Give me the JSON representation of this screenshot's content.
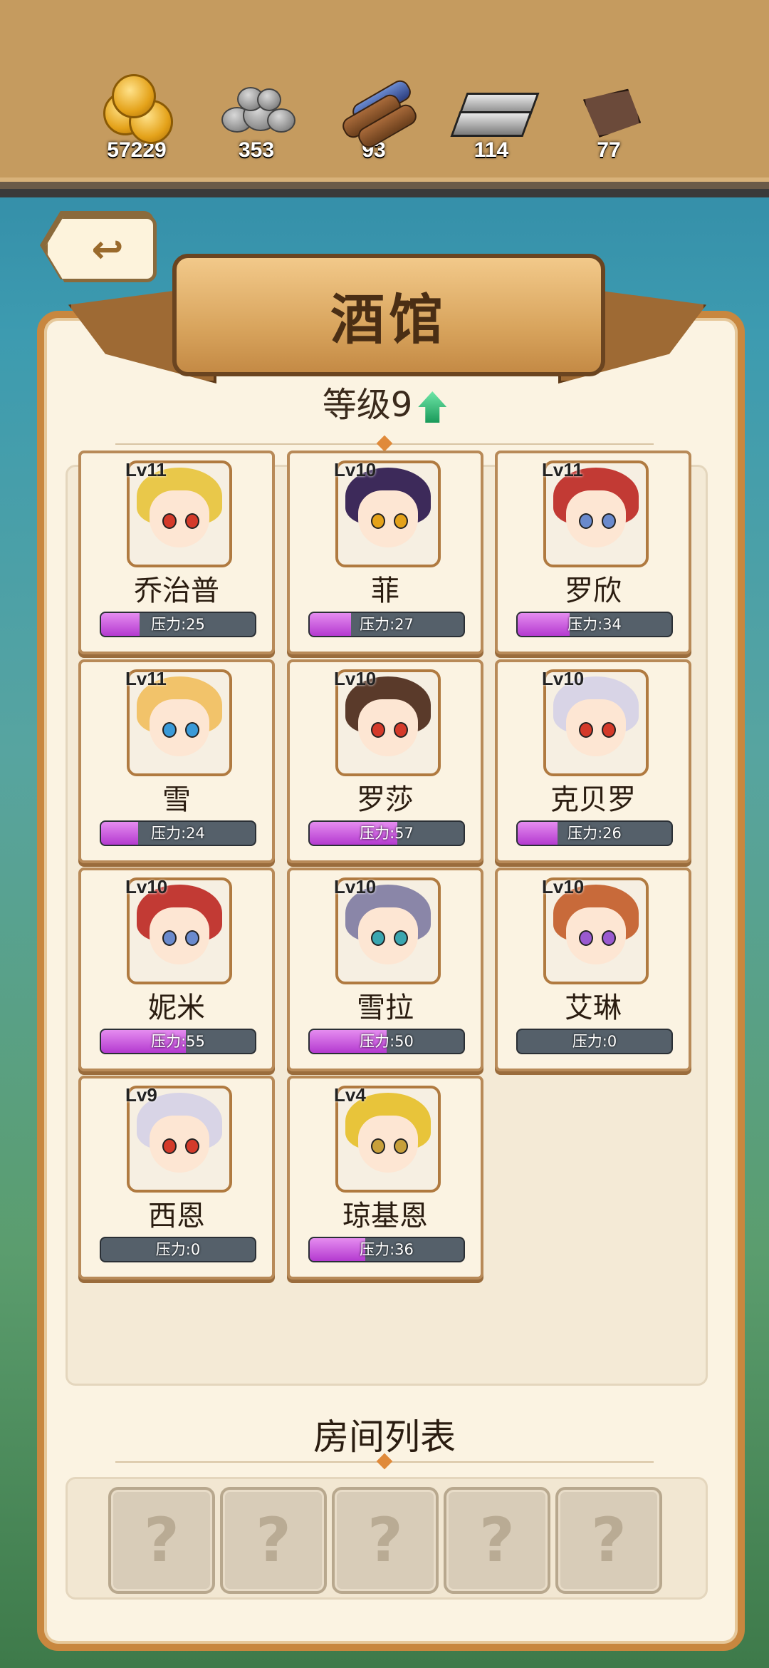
{
  "resources": [
    {
      "icon": "gold-coins-icon",
      "value": "57229"
    },
    {
      "icon": "stone-icon",
      "value": "353"
    },
    {
      "icon": "wood-logs-icon",
      "value": "93"
    },
    {
      "icon": "iron-ingot-icon",
      "value": "114"
    },
    {
      "icon": "leather-icon",
      "value": "77"
    }
  ],
  "back_icon": "back-arrow-icon",
  "title": "酒馆",
  "level": "等级9",
  "heroes": [
    {
      "level": "Lv11",
      "name": "乔治普",
      "pressure_label": "压力:25",
      "pressure": 25,
      "hair": "#e9c84a",
      "eye": "#d43a2a"
    },
    {
      "level": "Lv10",
      "name": "菲",
      "pressure_label": "压力:27",
      "pressure": 27,
      "hair": "#3d2a5a",
      "eye": "#e4a21a"
    },
    {
      "level": "Lv11",
      "name": "罗欣",
      "pressure_label": "压力:34",
      "pressure": 34,
      "hair": "#c23a34",
      "eye": "#6a8acd"
    },
    {
      "level": "Lv11",
      "name": "雪",
      "pressure_label": "压力:24",
      "pressure": 24,
      "hair": "#f2c36a",
      "eye": "#3a9ad8"
    },
    {
      "level": "Lv10",
      "name": "罗莎",
      "pressure_label": "压力:57",
      "pressure": 57,
      "hair": "#5a3a2a",
      "eye": "#d43a2a"
    },
    {
      "level": "Lv10",
      "name": "克贝罗",
      "pressure_label": "压力:26",
      "pressure": 26,
      "hair": "#d8d4e6",
      "eye": "#d43a2a"
    },
    {
      "level": "Lv10",
      "name": "妮米",
      "pressure_label": "压力:55",
      "pressure": 55,
      "hair": "#c23a34",
      "eye": "#6a8acd"
    },
    {
      "level": "Lv10",
      "name": "雪拉",
      "pressure_label": "压力:50",
      "pressure": 50,
      "hair": "#8a86a8",
      "eye": "#3aa6b0"
    },
    {
      "level": "Lv10",
      "name": "艾琳",
      "pressure_label": "压力:0",
      "pressure": 0,
      "hair": "#c86a3a",
      "eye": "#9a5ad0"
    },
    {
      "level": "Lv9",
      "name": "西恩",
      "pressure_label": "压力:0",
      "pressure": 0,
      "hair": "#d8d4e6",
      "eye": "#d43a2a"
    },
    {
      "level": "Lv4",
      "name": "琼基恩",
      "pressure_label": "压力:36",
      "pressure": 36,
      "hair": "#e8c43a",
      "eye": "#c8a03a"
    }
  ],
  "room_list_title": "房间列表",
  "rooms": [
    "?",
    "?",
    "?",
    "?",
    "?"
  ]
}
